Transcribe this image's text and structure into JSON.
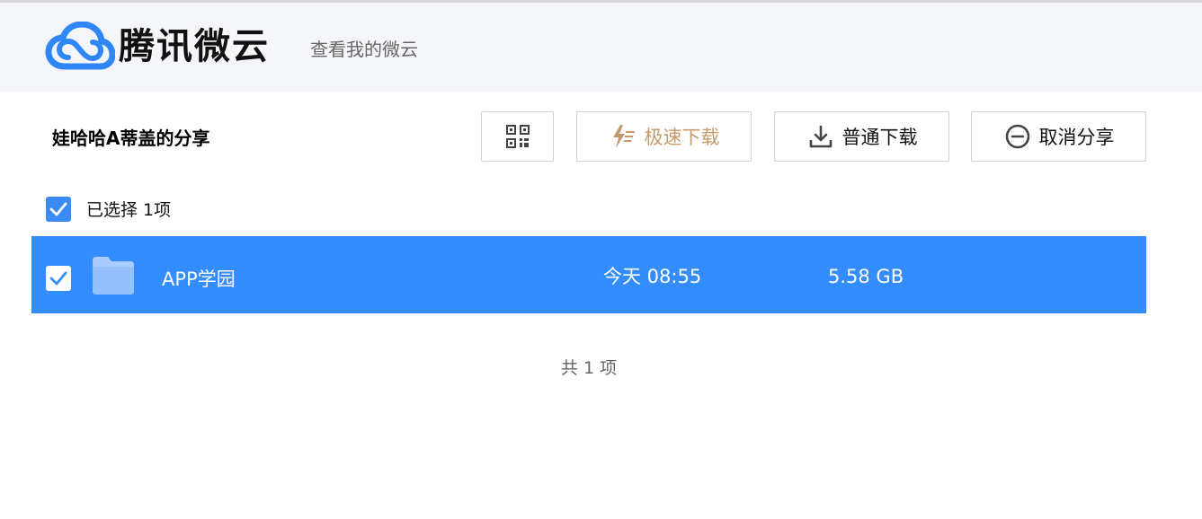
{
  "header": {
    "brand_name": "腾讯微云",
    "view_link": "查看我的微云"
  },
  "share": {
    "title": "娃哈哈A蒂盖的分享"
  },
  "toolbar": {
    "qr_icon": "qrcode-icon",
    "fast_download_label": "极速下载",
    "fast_download_icon": "lightning-icon",
    "normal_download_label": "普通下载",
    "normal_download_icon": "download-icon",
    "cancel_share_label": "取消分享",
    "cancel_share_icon": "minus-circle-icon"
  },
  "selection": {
    "label": "已选择 1项",
    "checked": true
  },
  "files": [
    {
      "name": "APP学园",
      "type": "folder",
      "modified": "今天 08:55",
      "size": "5.58 GB",
      "selected": true
    }
  ],
  "footer": {
    "total": "共 1 项"
  },
  "colors": {
    "accent": "#3a8bf5",
    "selected_row": "#338dff",
    "fast_download": "#c49a6c",
    "header_bg": "#f4f6f9",
    "folder": "#a9cdff"
  }
}
